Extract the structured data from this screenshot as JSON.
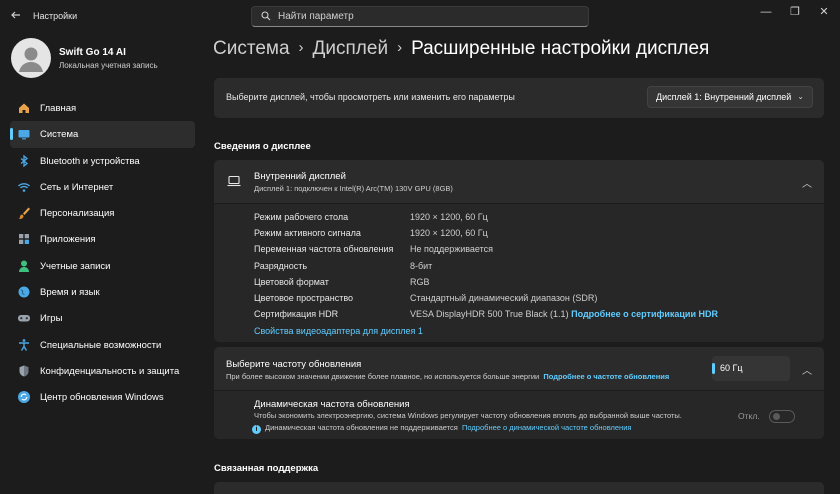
{
  "window": {
    "app_title": "Настройки",
    "search_placeholder": "Найти параметр",
    "minimize": "—",
    "maximize": "❐",
    "close": "✕"
  },
  "profile": {
    "name": "Swift Go 14 AI",
    "account_type": "Локальная учетная запись"
  },
  "sidebar": {
    "items": [
      {
        "label": "Главная",
        "icon": "home-icon"
      },
      {
        "label": "Система",
        "icon": "system-icon",
        "active": true
      },
      {
        "label": "Bluetooth и устройства",
        "icon": "bluetooth-icon"
      },
      {
        "label": "Сеть и Интернет",
        "icon": "wifi-icon"
      },
      {
        "label": "Персонализация",
        "icon": "brush-icon"
      },
      {
        "label": "Приложения",
        "icon": "apps-icon"
      },
      {
        "label": "Учетные записи",
        "icon": "account-icon"
      },
      {
        "label": "Время и язык",
        "icon": "globe-icon"
      },
      {
        "label": "Игры",
        "icon": "gamepad-icon"
      },
      {
        "label": "Специальные возможности",
        "icon": "accessibility-icon"
      },
      {
        "label": "Конфиденциальность и защита",
        "icon": "shield-icon"
      },
      {
        "label": "Центр обновления Windows",
        "icon": "update-icon"
      }
    ]
  },
  "breadcrumb": {
    "part1": "Система",
    "part2": "Дисплей",
    "part3": "Расширенные настройки дисплея",
    "separator": "›"
  },
  "display_select": {
    "label": "Выберите дисплей, чтобы просмотреть или изменить его параметры",
    "value": "Дисплей 1: Внутренний дисплей"
  },
  "display_info": {
    "heading": "Сведения о дисплее",
    "title": "Внутренний дисплей",
    "subtitle": "Дисплей 1: подключен к Intel(R) Arc(TM) 130V GPU (8GB)",
    "props": [
      {
        "label": "Режим рабочего стола",
        "value": "1920 × 1200, 60 Гц"
      },
      {
        "label": "Режим активного сигнала",
        "value": "1920 × 1200, 60 Гц"
      },
      {
        "label": "Переменная частота обновления",
        "value": "Не поддерживается"
      },
      {
        "label": "Разрядность",
        "value": "8-бит"
      },
      {
        "label": "Цветовой формат",
        "value": "RGB"
      },
      {
        "label": "Цветовое пространство",
        "value": "Стандартный динамический диапазон (SDR)"
      },
      {
        "label": "Сертификация HDR",
        "value": "VESA DisplayHDR 500 True Black (1.1)"
      }
    ],
    "hdr_link": "Подробнее о сертификации HDR",
    "adapter_link": "Свойства видеоадаптера для дисплея 1"
  },
  "refresh_rate": {
    "title": "Выберите частоту обновления",
    "desc": "При более высоком значении движение более плавное, но используется больше энергии",
    "desc_link": "Подробнее о частоте обновления",
    "value": "60 Гц"
  },
  "dynamic_refresh": {
    "title": "Динамическая частота обновления",
    "desc": "Чтобы экономить электроэнергию, система Windows регулирует частоту обновления вплоть до выбранной выше частоты.",
    "note": "Динамическая частота обновления не поддерживается",
    "note_link": "Подробнее о динамической частоте обновления",
    "toggle_label": "Откл."
  },
  "related": {
    "heading": "Связанная поддержка"
  },
  "colors": {
    "accent": "#60cdff",
    "background": "#1c1c1c",
    "card": "#2b2b2b"
  }
}
